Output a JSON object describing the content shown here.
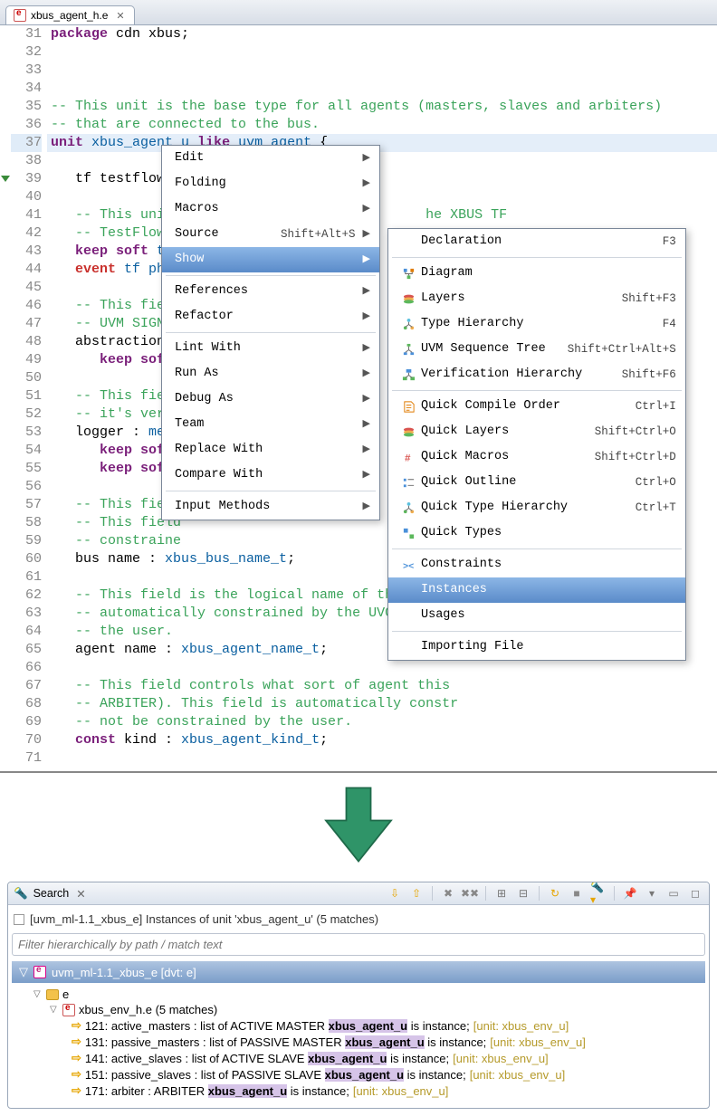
{
  "tab": {
    "filename": "xbus_agent_h.e",
    "close": "✕"
  },
  "gutter_start": 31,
  "code_lines": [
    {
      "n": 31,
      "html": "<span class='kw'>package</span> cdn xbus;"
    },
    {
      "n": 32,
      "html": ""
    },
    {
      "n": 33,
      "html": ""
    },
    {
      "n": 34,
      "html": ""
    },
    {
      "n": 35,
      "html": "<span class='cmt'>-- This unit is the base type for all agents (masters, slaves and arbiters)</span>"
    },
    {
      "n": 36,
      "html": "<span class='cmt'>-- that are connected to the bus.</span>"
    },
    {
      "n": 37,
      "hl": true,
      "html": "<span class='kw'>unit</span> <span class='typ'>xbus_agent_u</span> <span class='kw'>like</span> <span class='typ'>uvm_agent</span> {"
    },
    {
      "n": 38,
      "html": ""
    },
    {
      "n": 39,
      "html": "   tf testflow u"
    },
    {
      "n": 40,
      "html": ""
    },
    {
      "n": 41,
      "html": "   <span class='cmt'>-- This unit                               he XBUS TF</span>"
    },
    {
      "n": 42,
      "html": "   <span class='cmt'>-- TestFlow d</span>"
    },
    {
      "n": 43,
      "html": "   <span class='kw'>keep soft</span> <span class='typ'>tf_</span>"
    },
    {
      "n": 44,
      "html": "   <span class='ev'>event</span> <span class='evn'>tf phas</span>"
    },
    {
      "n": 45,
      "html": ""
    },
    {
      "n": 46,
      "html": "   <span class='cmt'>-- This field</span>"
    },
    {
      "n": 47,
      "html": "   <span class='cmt'>-- UVM SIGNAL</span>"
    },
    {
      "n": 48,
      "html": "   abstraction l"
    },
    {
      "n": 49,
      "html": "      <span class='kw'>keep soft</span> a"
    },
    {
      "n": 50,
      "html": ""
    },
    {
      "n": 51,
      "html": "   <span class='cmt'>-- This field</span>"
    },
    {
      "n": 52,
      "html": "   <span class='cmt'>-- it's verbo</span>"
    },
    {
      "n": 53,
      "html": "   logger : <span class='typ'>mess</span>"
    },
    {
      "n": 54,
      "html": "      <span class='kw'>keep soft</span>"
    },
    {
      "n": 55,
      "html": "      <span class='kw'>keep soft</span>"
    },
    {
      "n": 56,
      "html": ""
    },
    {
      "n": 57,
      "html": "   <span class='cmt'>-- This field</span>"
    },
    {
      "n": 58,
      "html": "   <span class='cmt'>-- This field</span>"
    },
    {
      "n": 59,
      "html": "   <span class='cmt'>-- constraine</span>"
    },
    {
      "n": 60,
      "html": "   bus name : <span class='typ'>xbus_bus_name_t</span>;"
    },
    {
      "n": 61,
      "html": ""
    },
    {
      "n": 62,
      "html": "   <span class='cmt'>-- This field is the logical name of the agent.</span>"
    },
    {
      "n": 63,
      "html": "   <span class='cmt'>-- automatically constrained by the UVC and sho</span>"
    },
    {
      "n": 64,
      "html": "   <span class='cmt'>-- the user.</span>"
    },
    {
      "n": 65,
      "html": "   agent name : <span class='typ'>xbus_agent_name_t</span>;"
    },
    {
      "n": 66,
      "html": ""
    },
    {
      "n": 67,
      "html": "   <span class='cmt'>-- This field controls what sort of agent this </span>"
    },
    {
      "n": 68,
      "html": "   <span class='cmt'>-- ARBITER). This field is automatically constr</span>"
    },
    {
      "n": 69,
      "html": "   <span class='cmt'>-- not be constrained by the user.</span>"
    },
    {
      "n": 70,
      "html": "   <span class='kw'>const</span> kind : <span class='typ'>xbus_agent_kind_t</span>;"
    },
    {
      "n": 71,
      "html": ""
    }
  ],
  "menu1": [
    {
      "label": "Edit",
      "sub": true
    },
    {
      "label": "Folding",
      "sub": true
    },
    {
      "label": "Macros",
      "sub": true
    },
    {
      "label": "Source",
      "shortcut": "Shift+Alt+S",
      "sub": true
    },
    {
      "label": "Show",
      "sel": true,
      "sub": true
    },
    {
      "sep": true
    },
    {
      "label": "References",
      "sub": true
    },
    {
      "label": "Refactor",
      "sub": true
    },
    {
      "sep": true
    },
    {
      "label": "Lint With",
      "sub": true
    },
    {
      "label": "Run As",
      "sub": true
    },
    {
      "label": "Debug As",
      "sub": true
    },
    {
      "label": "Team",
      "sub": true
    },
    {
      "label": "Replace With",
      "sub": true
    },
    {
      "label": "Compare With",
      "sub": true
    },
    {
      "sep": true
    },
    {
      "label": "Input Methods",
      "sub": true
    }
  ],
  "menu2": [
    {
      "icon": "",
      "label": "Declaration",
      "shortcut": "F3"
    },
    {
      "sep": true
    },
    {
      "icon": "diagram",
      "label": "Diagram"
    },
    {
      "icon": "layers",
      "label": "Layers",
      "shortcut": "Shift+F3"
    },
    {
      "icon": "typeh",
      "label": "Type Hierarchy",
      "shortcut": "F4"
    },
    {
      "icon": "seqtree",
      "label": "UVM Sequence Tree",
      "shortcut": "Shift+Ctrl+Alt+S"
    },
    {
      "icon": "verh",
      "label": "Verification Hierarchy",
      "shortcut": "Shift+F6"
    },
    {
      "sep": true
    },
    {
      "icon": "qcompile",
      "label": "Quick Compile Order",
      "shortcut": "Ctrl+I"
    },
    {
      "icon": "qlayers",
      "label": "Quick Layers",
      "shortcut": "Shift+Ctrl+O"
    },
    {
      "icon": "qmacros",
      "label": "Quick Macros",
      "shortcut": "Shift+Ctrl+D"
    },
    {
      "icon": "qoutline",
      "label": "Quick Outline",
      "shortcut": "Ctrl+O"
    },
    {
      "icon": "qtypeh",
      "label": "Quick Type Hierarchy",
      "shortcut": "Ctrl+T"
    },
    {
      "icon": "qtypes",
      "label": "Quick Types"
    },
    {
      "sep": true
    },
    {
      "icon": "constr",
      "label": "Constraints"
    },
    {
      "icon": "",
      "label": "Instances",
      "sel": true
    },
    {
      "icon": "",
      "label": "Usages"
    },
    {
      "sep": true
    },
    {
      "icon": "",
      "label": "Importing File"
    }
  ],
  "search": {
    "tab_title": "Search",
    "summary": "[uvm_ml-1.1_xbus_e] Instances of unit 'xbus_agent_u' (5 matches)",
    "filter_placeholder": "Filter hierarchically by path / match text",
    "project": "uvm_ml-1.1_xbus_e [dvt: e]",
    "folder": "e",
    "file": "xbus_env_h.e (5 matches)",
    "matches": [
      {
        "loc": "121:",
        "pre": "active_masters : list of ACTIVE MASTER ",
        "hit": "xbus_agent_u",
        "post": " is instance;",
        "unit": "  [unit: xbus_env_u]"
      },
      {
        "loc": "131:",
        "pre": "passive_masters : list of PASSIVE MASTER ",
        "hit": "xbus_agent_u",
        "post": " is instance;",
        "unit": "  [unit: xbus_env_u]"
      },
      {
        "loc": "141:",
        "pre": "active_slaves : list of ACTIVE SLAVE ",
        "hit": "xbus_agent_u",
        "post": " is instance;",
        "unit": "  [unit: xbus_env_u]"
      },
      {
        "loc": "151:",
        "pre": "passive_slaves : list of PASSIVE SLAVE ",
        "hit": "xbus_agent_u",
        "post": " is instance;",
        "unit": "  [unit: xbus_env_u]"
      },
      {
        "loc": "171:",
        "pre": "arbiter : ARBITER ",
        "hit": "xbus_agent_u",
        "post": " is instance;",
        "unit": "  [unit: xbus_env_u]"
      }
    ]
  }
}
